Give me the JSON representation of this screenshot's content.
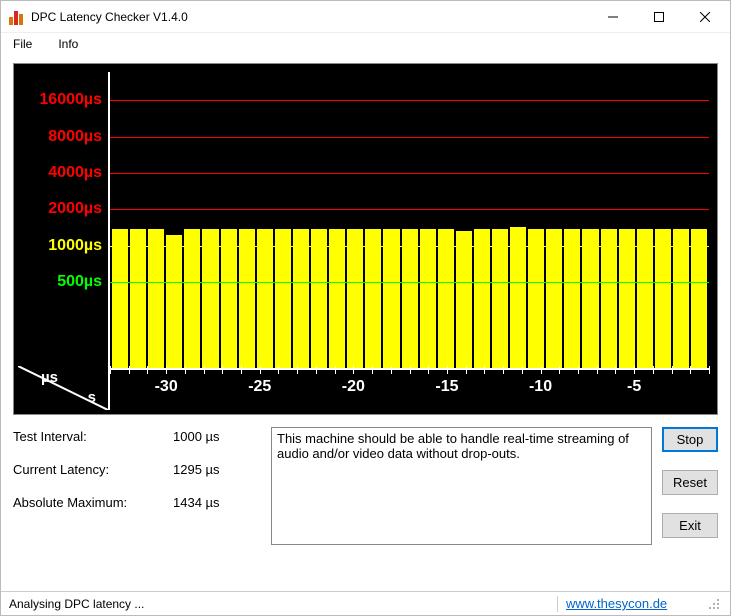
{
  "window": {
    "title": "DPC Latency Checker V1.4.0"
  },
  "menu": {
    "file": "File",
    "info": "Info"
  },
  "chart_data": {
    "type": "bar",
    "title": "",
    "xlabel": "s",
    "ylabel": "µs",
    "x_ticks": [
      -30,
      -25,
      -20,
      -15,
      -10,
      -5
    ],
    "y_ticks": [
      {
        "v": 500,
        "label": "500µs",
        "color": "#00ff00"
      },
      {
        "v": 1000,
        "label": "1000µs",
        "color": "#ffff00"
      },
      {
        "v": 2000,
        "label": "2000µs",
        "color": "#ff0000"
      },
      {
        "v": 4000,
        "label": "4000µs",
        "color": "#ff0000"
      },
      {
        "v": 8000,
        "label": "8000µs",
        "color": "#ff0000"
      },
      {
        "v": 16000,
        "label": "16000µs",
        "color": "#ff0000"
      }
    ],
    "ylim": [
      0,
      20000
    ],
    "x": [
      -33,
      -32,
      -31,
      -30,
      -29,
      -28,
      -27,
      -26,
      -25,
      -24,
      -23,
      -22,
      -21,
      -20,
      -19,
      -18,
      -17,
      -16,
      -15,
      -14,
      -13,
      -12,
      -11,
      -10,
      -9,
      -8,
      -7,
      -6,
      -5,
      -4,
      -3,
      -2,
      -1
    ],
    "values": [
      1350,
      1350,
      1350,
      1200,
      1350,
      1350,
      1350,
      1350,
      1350,
      1350,
      1350,
      1350,
      1350,
      1350,
      1350,
      1350,
      1350,
      1350,
      1350,
      1300,
      1350,
      1350,
      1400,
      1350,
      1350,
      1350,
      1350,
      1350,
      1350,
      1350,
      1350,
      1350,
      1350
    ],
    "y_scale": "log"
  },
  "readouts": {
    "interval_label": "Test Interval:",
    "interval_value": "1000 µs",
    "current_label": "Current Latency:",
    "current_value": "1295 µs",
    "max_label": "Absolute Maximum:",
    "max_value": "1434 µs"
  },
  "message": "This machine should be able to handle real-time streaming of audio and/or video data without drop-outs.",
  "buttons": {
    "stop": "Stop",
    "reset": "Reset",
    "exit": "Exit"
  },
  "status": {
    "text": "Analysing DPC latency ...",
    "link": "www.thesycon.de"
  }
}
